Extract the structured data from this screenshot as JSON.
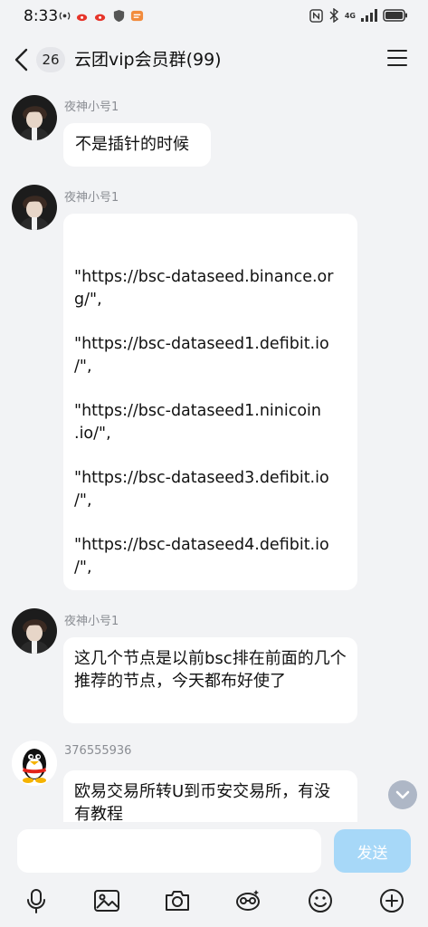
{
  "status_bar": {
    "time": "8:33",
    "network": "4G",
    "icons": [
      "nfc-icon",
      "bluetooth-icon",
      "signal-icon",
      "battery-icon"
    ]
  },
  "header": {
    "unread_count": "26",
    "title": "云团vip会员群(99)"
  },
  "messages": [
    {
      "sender": "夜神小号1",
      "avatar": "avatar-dark-character",
      "text": "不是插针的时候"
    },
    {
      "sender": "夜神小号1",
      "avatar": "avatar-dark-character",
      "links": [
        {
          "prefix": "\"",
          "line1": "https://bsc-dataseed.binance.or",
          "line2": "g/",
          "suffix": "\","
        },
        {
          "prefix": "\"",
          "line1": "https://bsc-dataseed1.defibit.io",
          "line2": "/",
          "suffix": "\","
        },
        {
          "prefix": "\"",
          "line1": "https://bsc-dataseed1.ninicoin",
          "line2": ".io/",
          "suffix": "\","
        },
        {
          "prefix": "\"",
          "line1": "https://bsc-dataseed3.defibit.io",
          "line2": "/",
          "suffix": "\","
        },
        {
          "prefix": "\"",
          "line1": "https://bsc-dataseed4.defibit.io",
          "line2": "/",
          "suffix": "\","
        }
      ]
    },
    {
      "sender": "夜神小号1",
      "avatar": "avatar-dark-character",
      "text": "这几个节点是以前bsc排在前面的几个 推荐的节点，今天都布好使了"
    },
    {
      "sender": "376555936",
      "avatar": "avatar-penguin",
      "text": "欧易交易所转U到币安交易所，有没有教程"
    }
  ],
  "input": {
    "placeholder": "",
    "send_label": "发送"
  },
  "toolbar": {
    "items": [
      "microphone-icon",
      "image-icon",
      "camera-icon",
      "red-packet-icon",
      "emoji-icon",
      "plus-icon"
    ]
  },
  "colors": {
    "background": "#f2f3f5",
    "link": "#2a55a0",
    "send_button": "#a7d8f8"
  }
}
